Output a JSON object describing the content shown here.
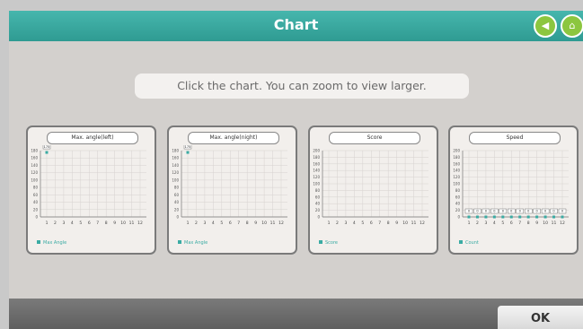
{
  "header": {
    "title": "Chart",
    "back_icon": "back-arrow-icon",
    "home_icon": "home-icon"
  },
  "instruction": "Click the chart. You can zoom to view larger.",
  "footer": {
    "ok_label": "OK"
  },
  "chart_data": [
    {
      "type": "line",
      "title": "Max. angle(left)",
      "x": [
        1,
        2,
        3,
        4,
        5,
        6,
        7,
        8,
        9,
        10,
        11,
        12
      ],
      "y_ticks": [
        0,
        20,
        40,
        60,
        80,
        100,
        120,
        140,
        160,
        180
      ],
      "ylim": [
        0,
        180
      ],
      "series": [
        {
          "name": "Max Angle",
          "values": [
            175
          ]
        }
      ],
      "data_labels": [
        "175"
      ]
    },
    {
      "type": "line",
      "title": "Max. angle(night)",
      "x": [
        1,
        2,
        3,
        4,
        5,
        6,
        7,
        8,
        9,
        10,
        11,
        12
      ],
      "y_ticks": [
        0,
        20,
        40,
        60,
        80,
        100,
        120,
        140,
        160,
        180
      ],
      "ylim": [
        0,
        180
      ],
      "series": [
        {
          "name": "Max Angle",
          "values": [
            175
          ]
        }
      ],
      "data_labels": [
        "175"
      ]
    },
    {
      "type": "line",
      "title": "Score",
      "x": [
        1,
        2,
        3,
        4,
        5,
        6,
        7,
        8,
        9,
        10,
        11,
        12
      ],
      "y_ticks": [
        0,
        20,
        40,
        60,
        80,
        100,
        120,
        140,
        160,
        180,
        200
      ],
      "ylim": [
        0,
        200
      ],
      "series": [
        {
          "name": "Score",
          "values": []
        }
      ]
    },
    {
      "type": "line",
      "title": "Speed",
      "x": [
        1,
        2,
        3,
        4,
        5,
        6,
        7,
        8,
        9,
        10,
        11,
        12
      ],
      "y_ticks": [
        0,
        20,
        40,
        60,
        80,
        100,
        120,
        140,
        160,
        180,
        200
      ],
      "ylim": [
        0,
        200
      ],
      "series": [
        {
          "name": "Count",
          "values": [
            0,
            0,
            0,
            0,
            0,
            0,
            0,
            0,
            0,
            0,
            0,
            0
          ]
        }
      ],
      "data_labels": [
        "0",
        "0",
        "0",
        "0",
        "0",
        "0",
        "0",
        "0",
        "0",
        "0",
        "0",
        "0"
      ]
    }
  ]
}
